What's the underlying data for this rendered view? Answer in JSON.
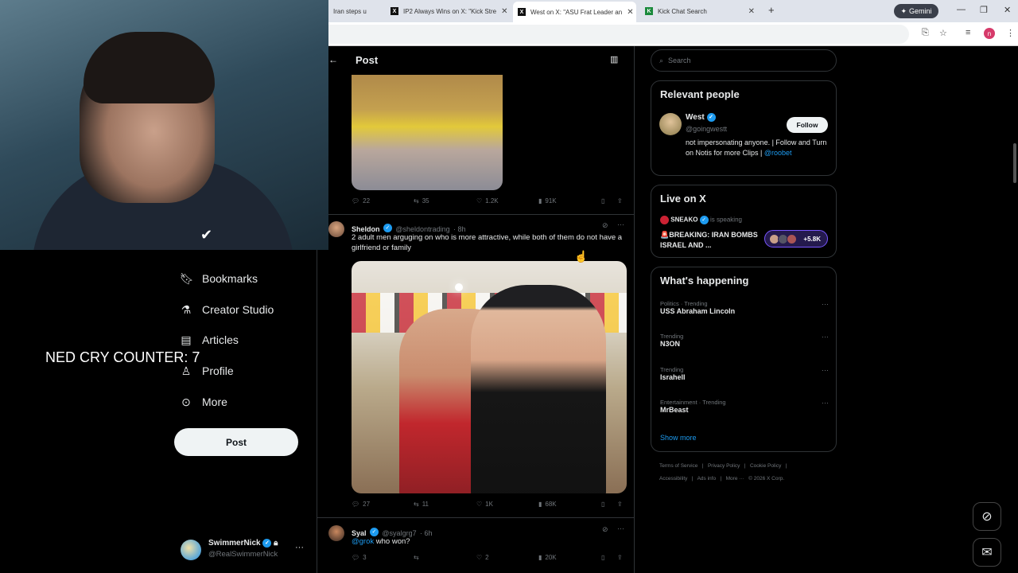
{
  "browser": {
    "tabs": [
      {
        "label": "Iran steps u",
        "icon": "generic"
      },
      {
        "label": "IP2 Always Wins on X: \"Kick Stre",
        "icon": "x"
      },
      {
        "label": "West on X: \"ASU Frat Leader an",
        "icon": "x"
      },
      {
        "label": "Kick Chat Search",
        "icon": "kick"
      }
    ],
    "new_tab": "+",
    "gemini_label": "Gemini",
    "profile_initial": "n"
  },
  "overlay": {
    "counter": "NED CRY COUNTER: 7"
  },
  "nav": {
    "items": [
      {
        "label": "Bookmarks",
        "icon": "bookmark-icon"
      },
      {
        "label": "Creator Studio",
        "icon": "flask-icon"
      },
      {
        "label": "Articles",
        "icon": "article-icon"
      },
      {
        "label": "Profile",
        "icon": "person-icon"
      },
      {
        "label": "More",
        "icon": "more-icon"
      }
    ],
    "post_button": "Post",
    "account": {
      "name": "SwimmerNick",
      "handle": "@RealSwimmerNick"
    }
  },
  "center": {
    "header_title": "Post",
    "tweet1_actions": {
      "replies": "22",
      "reposts": "35",
      "likes": "1.2K",
      "views": "91K"
    },
    "tweet2": {
      "name": "Sheldon",
      "handle": "@sheldontrading",
      "time": "· 8h",
      "text": "2 adult men arguging on who is more attractive, while both of them do not have a girlfriend or family",
      "actions": {
        "replies": "27",
        "reposts": "11",
        "likes": "1K",
        "views": "68K"
      }
    },
    "tweet3": {
      "name": "Syal",
      "handle": "@syalgrg7",
      "time": "· 6h",
      "mention": "@grok",
      "text": " who won?",
      "actions": {
        "replies": "3",
        "reposts": "",
        "likes": "2",
        "views": "20K"
      }
    }
  },
  "right": {
    "search_placeholder": "Search",
    "relevant": {
      "title": "Relevant people",
      "name": "West",
      "handle": "@goingwestt",
      "follow": "Follow",
      "bio": "not impersonating anyone. | Follow and Turn on Notis for more Clips |",
      "bio_link": "@roobet"
    },
    "live": {
      "title": "Live on X",
      "host": "SNEAKO",
      "status": "is speaking",
      "headline": "🚨BREAKING: IRAN BOMBS ISRAEL AND ...",
      "listeners": "+5.8K"
    },
    "happening": {
      "title": "What's happening",
      "trends": [
        {
          "category": "Politics · Trending",
          "name": "USS Abraham Lincoln"
        },
        {
          "category": "Trending",
          "name": "N3ON"
        },
        {
          "category": "Trending",
          "name": "Israhell"
        },
        {
          "category": "Entertainment · Trending",
          "name": "MrBeast"
        }
      ],
      "show_more": "Show more"
    },
    "footer_line1": [
      "Terms of Service",
      "|",
      "Privacy Policy",
      "|",
      "Cookie Policy",
      "|"
    ],
    "footer_line2": [
      "Accessibility",
      "|",
      "Ads info",
      "|",
      "More ···",
      "© 2026 X Corp."
    ]
  },
  "colors": {
    "accent": "#1d9bf0",
    "live": "#7856ff",
    "background": "#000000"
  }
}
